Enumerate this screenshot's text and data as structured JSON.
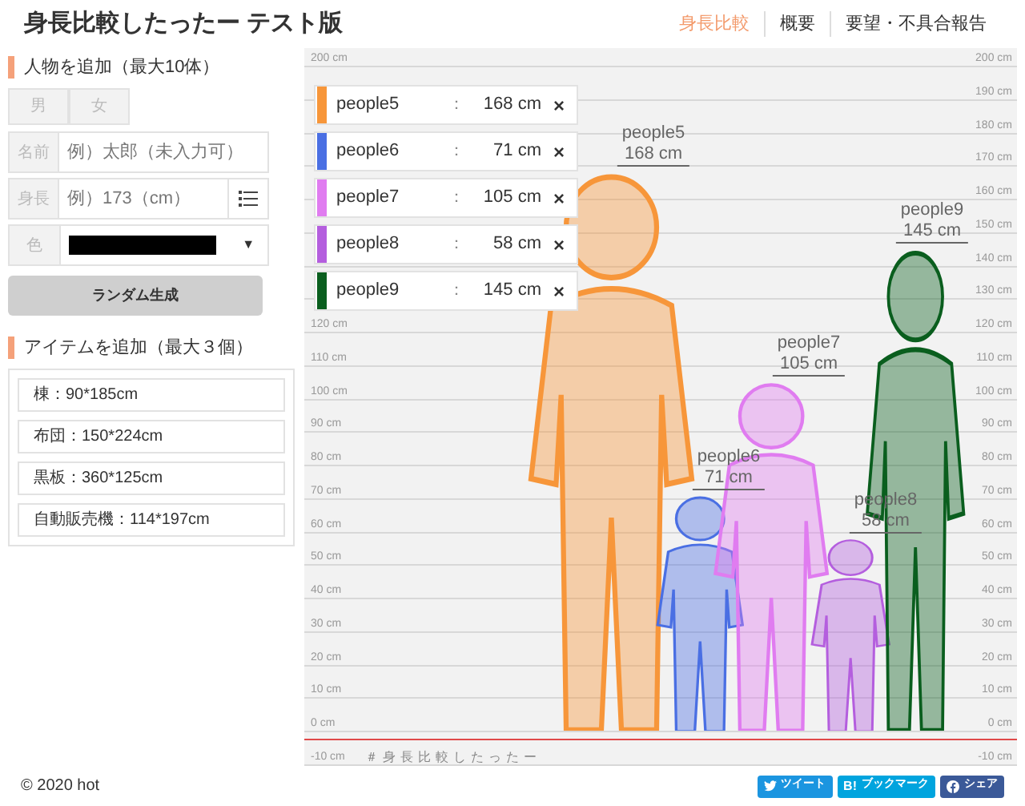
{
  "header": {
    "title": "身長比較したったー テスト版"
  },
  "nav": [
    {
      "label": "身長比較",
      "selected": true
    },
    {
      "label": "概要",
      "selected": false
    },
    {
      "label": "要望・不具合報告",
      "selected": false
    }
  ],
  "person_form": {
    "heading": "人物を追加（最大10体）",
    "genders": [
      "男",
      "女"
    ],
    "name_label": "名前",
    "name_placeholder": "例）太郎（未入力可）",
    "height_label": "身長",
    "height_placeholder": "例）173（cm）",
    "color_label": "色",
    "color": "#000000",
    "color_caret": "▼",
    "random_button": "ランダム生成"
  },
  "item_form": {
    "heading": "アイテムを追加（最大３個）",
    "items": [
      "棟：90*185cm",
      "布団：150*224cm",
      "黒板：360*125cm",
      "自動販売機：114*197cm"
    ]
  },
  "chart": {
    "left_ticks": [
      "200 cm",
      "120 cm",
      "110 cm",
      "100 cm",
      "90 cm",
      "80 cm",
      "70 cm",
      "60 cm",
      "50 cm",
      "40 cm",
      "30 cm",
      "20 cm",
      "10 cm",
      "0 cm",
      "-10 cm"
    ],
    "right_ticks": [
      "200 cm",
      "190 cm",
      "180 cm",
      "170 cm",
      "160 cm",
      "150 cm",
      "140 cm",
      "130 cm",
      "120 cm",
      "110 cm",
      "100 cm",
      "90 cm",
      "80 cm",
      "70 cm",
      "60 cm",
      "50 cm",
      "40 cm",
      "30 cm",
      "20 cm",
      "10 cm",
      "0 cm",
      "-10 cm"
    ],
    "hashtag": "＃身長比較したったー"
  },
  "cards": [
    {
      "name": "people5",
      "separator": "：",
      "height": "168 cm",
      "remove": "×",
      "color": "#f7963a"
    },
    {
      "name": "people6",
      "separator": "：",
      "height": "71 cm",
      "remove": "×",
      "color": "#4a6fe3"
    },
    {
      "name": "people7",
      "separator": "：",
      "height": "105 cm",
      "remove": "×",
      "color": "#e07cf0"
    },
    {
      "name": "people8",
      "separator": "：",
      "height": "58 cm",
      "remove": "×",
      "color": "#b45ede"
    },
    {
      "name": "people9",
      "separator": "：",
      "height": "145 cm",
      "remove": "×",
      "color": "#0a5e1e"
    }
  ],
  "figures": [
    {
      "name": "people5",
      "height": "168 cm",
      "color": "#f7963a"
    },
    {
      "name": "people6",
      "height": "71 cm",
      "color": "#4a6fe3"
    },
    {
      "name": "people7",
      "height": "105 cm",
      "color": "#e07cf0"
    },
    {
      "name": "people8",
      "height": "58 cm",
      "color": "#b45ede"
    },
    {
      "name": "people9",
      "height": "145 cm",
      "color": "#0a5e1e"
    }
  ],
  "footer": {
    "copyright": "© 2020 hot",
    "share": [
      {
        "kind": "twitter",
        "label": "ツイート"
      },
      {
        "kind": "hatena",
        "mark": "B!",
        "label": "ブックマーク"
      },
      {
        "kind": "facebook",
        "label": "シェア"
      }
    ]
  }
}
